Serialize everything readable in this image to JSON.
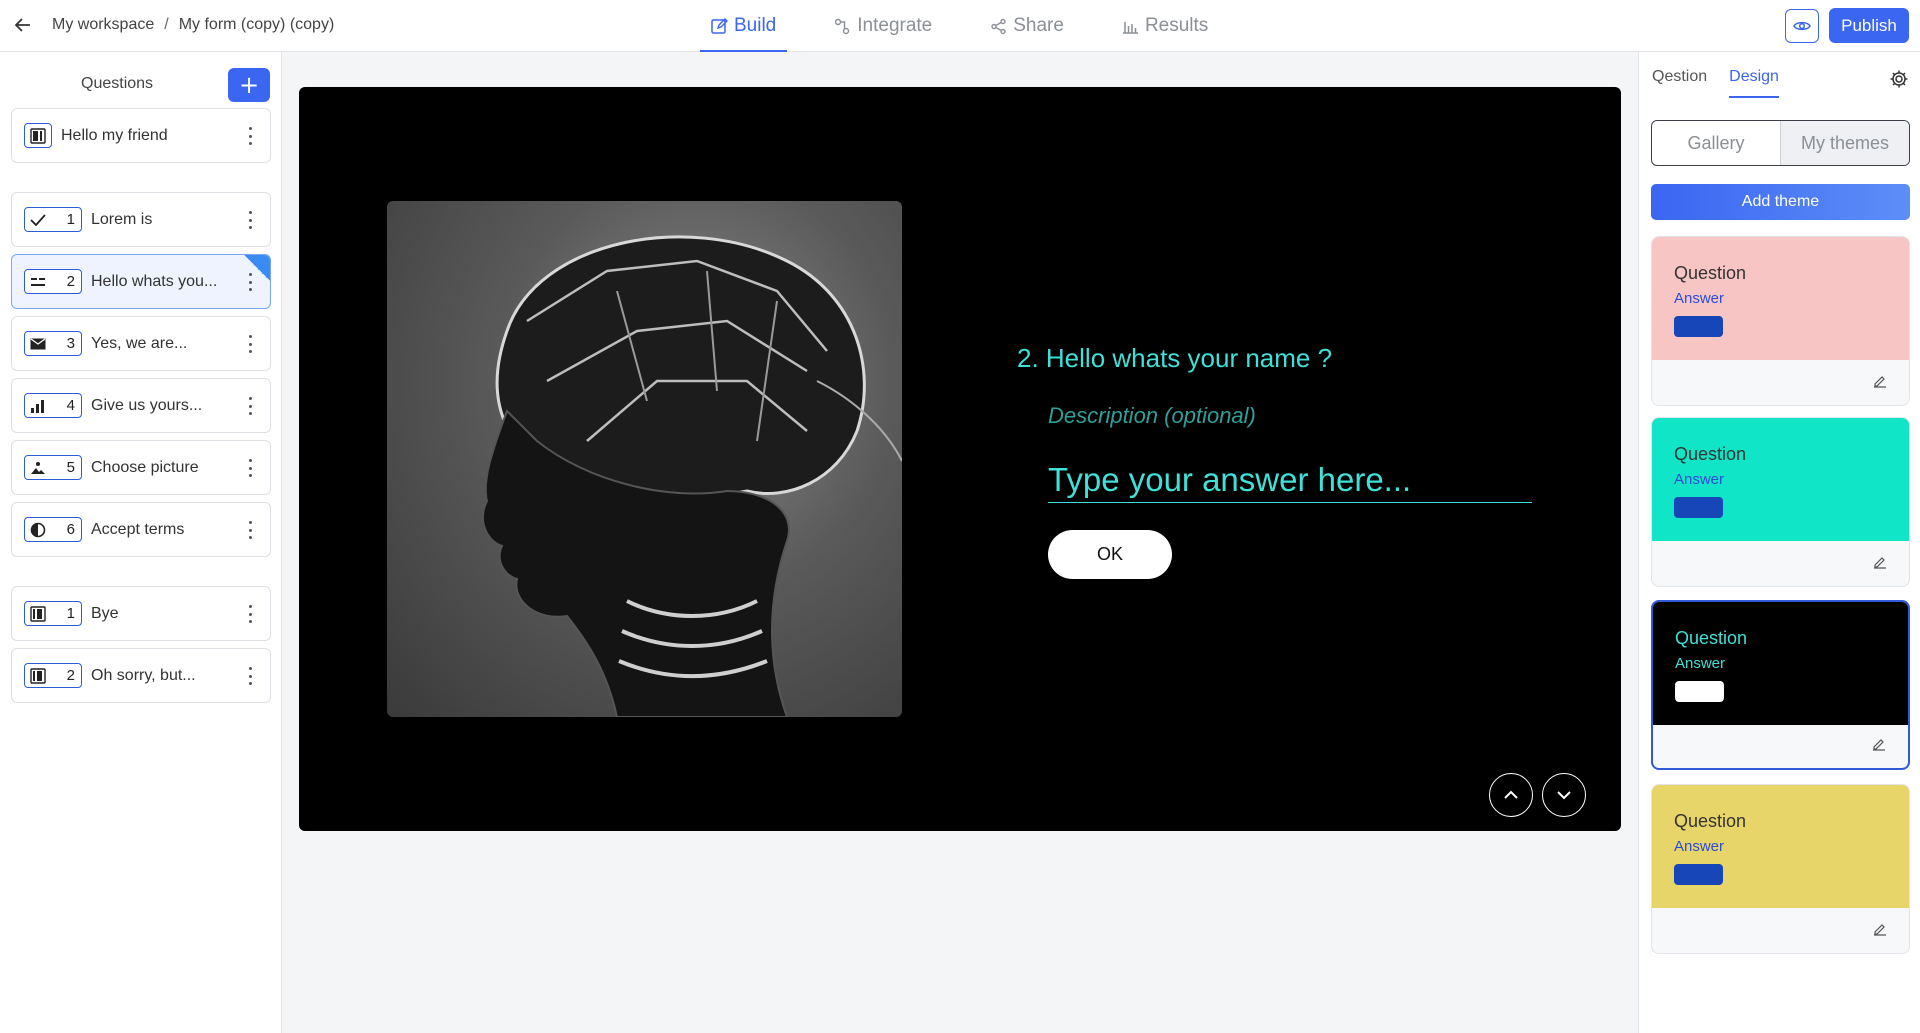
{
  "topbar": {
    "breadcrumb_workspace": "My workspace",
    "breadcrumb_separator": "/",
    "breadcrumb_form": "My form (copy) (copy)",
    "tabs": [
      {
        "label": "Build",
        "icon": "edit-icon",
        "active": true
      },
      {
        "label": "Integrate",
        "icon": "integrate-icon",
        "active": false
      },
      {
        "label": "Share",
        "icon": "share-icon",
        "active": false
      },
      {
        "label": "Results",
        "icon": "bar-chart-icon",
        "active": false
      }
    ],
    "publish_label": "Publish",
    "accent_color": "#3a66f2"
  },
  "sidebar": {
    "title": "Questions",
    "add_label": "+",
    "welcome": {
      "label": "Hello my friend",
      "icon": "welcome-screen-icon"
    },
    "questions": [
      {
        "num": "1",
        "label": "Lorem is",
        "icon": "check-icon"
      },
      {
        "num": "2",
        "label": "Hello whats you...",
        "icon": "short-text-icon",
        "active": true
      },
      {
        "num": "3",
        "label": "Yes, we are...",
        "icon": "email-icon"
      },
      {
        "num": "4",
        "label": "Give us yours...",
        "icon": "rating-bars-icon"
      },
      {
        "num": "5",
        "label": "Choose picture",
        "icon": "picture-choice-icon"
      },
      {
        "num": "6",
        "label": "Accept terms",
        "icon": "legal-icon"
      }
    ],
    "endings": [
      {
        "num": "1",
        "label": "Bye",
        "icon": "ending-screen-icon"
      },
      {
        "num": "2",
        "label": "Oh sorry, but...",
        "icon": "ending-screen-icon"
      }
    ]
  },
  "preview": {
    "question_title": "2. Hello whats your name ?",
    "description": "Description (optional)",
    "answer_placeholder": "Type your answer here...",
    "ok_label": "OK",
    "background_color": "#000000",
    "text_color": "#3fe0d8"
  },
  "design": {
    "tabs": [
      {
        "label": "Qestion",
        "active": false
      },
      {
        "label": "Design",
        "active": true
      }
    ],
    "segment": [
      {
        "label": "Gallery",
        "selected": false
      },
      {
        "label": "My themes",
        "selected": true
      }
    ],
    "add_theme_label": "Add theme",
    "themes": [
      {
        "question": "Question",
        "answer": "Answer",
        "bg": "#f8c5c5",
        "q_color": "#333333",
        "a_color": "#2b4dd6",
        "btn_color": "#1646b8",
        "selected": false
      },
      {
        "question": "Question",
        "answer": "Answer",
        "bg": "#10e5c8",
        "q_color": "#333333",
        "a_color": "#2b4dd6",
        "btn_color": "#1646b8",
        "selected": false
      },
      {
        "question": "Question",
        "answer": "Answer",
        "bg": "#000000",
        "q_color": "#3fe0d8",
        "a_color": "#3fe0d8",
        "btn_color": "#ffffff",
        "selected": true
      },
      {
        "question": "Question",
        "answer": "Answer",
        "bg": "#e8d56a",
        "q_color": "#333333",
        "a_color": "#2b4dd6",
        "btn_color": "#1646b8",
        "selected": false
      }
    ]
  }
}
